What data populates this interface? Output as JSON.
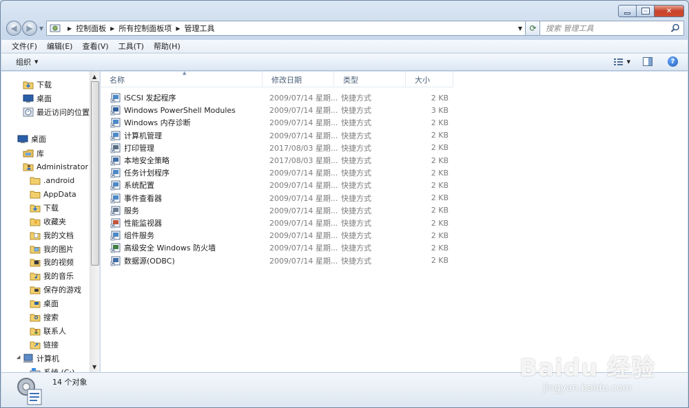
{
  "window": {
    "caption": {
      "minimize": "—",
      "maximize": "▢",
      "close": "✕"
    }
  },
  "address": {
    "crumbs": [
      "控制面板",
      "所有控制面板项",
      "管理工具"
    ],
    "search_placeholder": "搜索 管理工具"
  },
  "menu": [
    "文件(F)",
    "编辑(E)",
    "查看(V)",
    "工具(T)",
    "帮助(H)"
  ],
  "toolbar": {
    "organize": "组织"
  },
  "nav": {
    "items": [
      {
        "label": "下载",
        "icon": "download-folder-icon",
        "indent": 0
      },
      {
        "label": "桌面",
        "icon": "desktop-icon",
        "indent": 0
      },
      {
        "label": "最近访问的位置",
        "icon": "recent-places-icon",
        "indent": 0
      },
      {
        "label": "桌面",
        "icon": "desktop-icon",
        "indent": -1
      },
      {
        "label": "库",
        "icon": "libraries-icon",
        "indent": 0
      },
      {
        "label": "Administrator",
        "icon": "user-folder-icon",
        "indent": 0
      },
      {
        "label": ".android",
        "icon": "folder-icon",
        "indent": 1
      },
      {
        "label": "AppData",
        "icon": "folder-icon",
        "indent": 1
      },
      {
        "label": "下载",
        "icon": "download-folder-icon",
        "indent": 1
      },
      {
        "label": "收藏夹",
        "icon": "favorites-folder-icon",
        "indent": 1
      },
      {
        "label": "我的文档",
        "icon": "documents-folder-icon",
        "indent": 1
      },
      {
        "label": "我的图片",
        "icon": "pictures-folder-icon",
        "indent": 1
      },
      {
        "label": "我的视频",
        "icon": "videos-folder-icon",
        "indent": 1
      },
      {
        "label": "我的音乐",
        "icon": "music-folder-icon",
        "indent": 1
      },
      {
        "label": "保存的游戏",
        "icon": "saved-games-folder-icon",
        "indent": 1
      },
      {
        "label": "桌面",
        "icon": "desktop-folder-icon",
        "indent": 1
      },
      {
        "label": "搜索",
        "icon": "searches-folder-icon",
        "indent": 1
      },
      {
        "label": "联系人",
        "icon": "contacts-folder-icon",
        "indent": 1
      },
      {
        "label": "链接",
        "icon": "links-folder-icon",
        "indent": 1
      },
      {
        "label": "计算机",
        "icon": "computer-icon",
        "indent": 0
      },
      {
        "label": "系统 (C:)",
        "icon": "drive-icon",
        "indent": 1
      }
    ]
  },
  "columns": {
    "name": "名称",
    "date": "修改日期",
    "type": "类型",
    "size": "大小"
  },
  "files": [
    {
      "name": "iSCSI 发起程序",
      "date": "2009/07/14 星期...",
      "type": "快捷方式",
      "size": "2 KB"
    },
    {
      "name": "Windows PowerShell Modules",
      "date": "2009/07/14 星期...",
      "type": "快捷方式",
      "size": "3 KB"
    },
    {
      "name": "Windows 内存诊断",
      "date": "2009/07/14 星期...",
      "type": "快捷方式",
      "size": "2 KB"
    },
    {
      "name": "计算机管理",
      "date": "2009/07/14 星期...",
      "type": "快捷方式",
      "size": "2 KB"
    },
    {
      "name": "打印管理",
      "date": "2017/08/03 星期...",
      "type": "快捷方式",
      "size": "2 KB"
    },
    {
      "name": "本地安全策略",
      "date": "2017/08/03 星期...",
      "type": "快捷方式",
      "size": "2 KB"
    },
    {
      "name": "任务计划程序",
      "date": "2009/07/14 星期...",
      "type": "快捷方式",
      "size": "2 KB"
    },
    {
      "name": "系统配置",
      "date": "2009/07/14 星期...",
      "type": "快捷方式",
      "size": "2 KB"
    },
    {
      "name": "事件查看器",
      "date": "2009/07/14 星期...",
      "type": "快捷方式",
      "size": "2 KB"
    },
    {
      "name": "服务",
      "date": "2009/07/14 星期...",
      "type": "快捷方式",
      "size": "2 KB"
    },
    {
      "name": "性能监视器",
      "date": "2009/07/14 星期...",
      "type": "快捷方式",
      "size": "2 KB"
    },
    {
      "name": "组件服务",
      "date": "2009/07/14 星期...",
      "type": "快捷方式",
      "size": "2 KB"
    },
    {
      "name": "高级安全 Windows 防火墙",
      "date": "2009/07/14 星期...",
      "type": "快捷方式",
      "size": "2 KB"
    },
    {
      "name": "数据源(ODBC)",
      "date": "2009/07/14 星期...",
      "type": "快捷方式",
      "size": "2 KB"
    }
  ],
  "status": {
    "count": "14 个对象"
  },
  "watermark": {
    "line1": "Baidu 经验",
    "line2": "jingyan.baidu.com"
  }
}
